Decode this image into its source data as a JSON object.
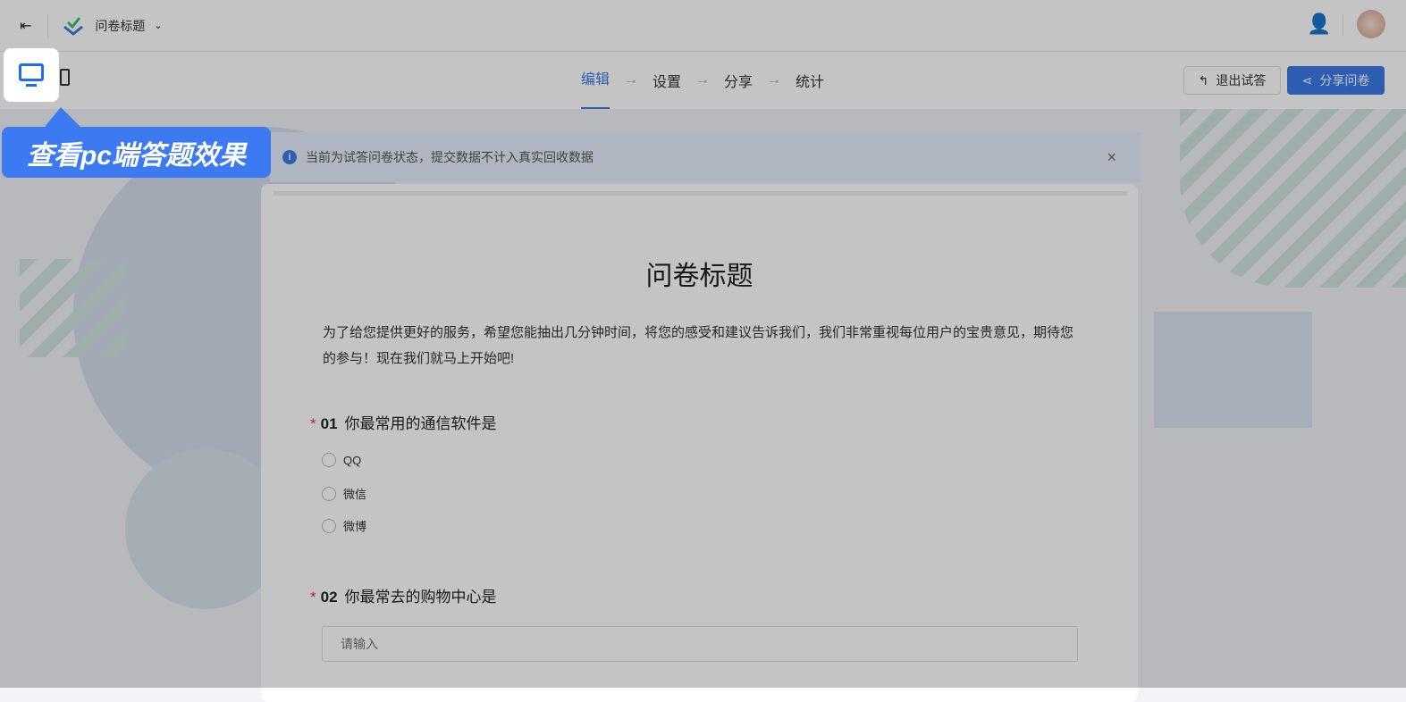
{
  "header": {
    "title": "问卷标题",
    "invite_icon": "user-plus-icon",
    "avatar": "avatar"
  },
  "steps": [
    {
      "label": "编辑"
    },
    {
      "label": "设置"
    },
    {
      "label": "分享"
    },
    {
      "label": "统计"
    }
  ],
  "actions": {
    "exit_trial": "退出试答",
    "share": "分享问卷"
  },
  "notice": {
    "text": "当前为试答问卷状态，提交数据不计入真实回收数据",
    "info": "i",
    "close": "×"
  },
  "guide": {
    "tip": "查看pc端答题效果"
  },
  "survey": {
    "title": "问卷标题",
    "description": "为了给您提供更好的服务，希望您能抽出几分钟时间，将您的感受和建议告诉我们，我们非常重视每位用户的宝贵意见，期待您的参与！现在我们就马上开始吧!",
    "questions": [
      {
        "required": "*",
        "number": "01",
        "text": "你最常用的通信软件是",
        "options": [
          "QQ",
          "微信",
          "微博"
        ]
      },
      {
        "required": "*",
        "number": "02",
        "text": "你最常去的购物中心是",
        "placeholder": "请输入"
      }
    ]
  },
  "colors": {
    "primary": "#3c7be8",
    "required": "#e53935"
  }
}
